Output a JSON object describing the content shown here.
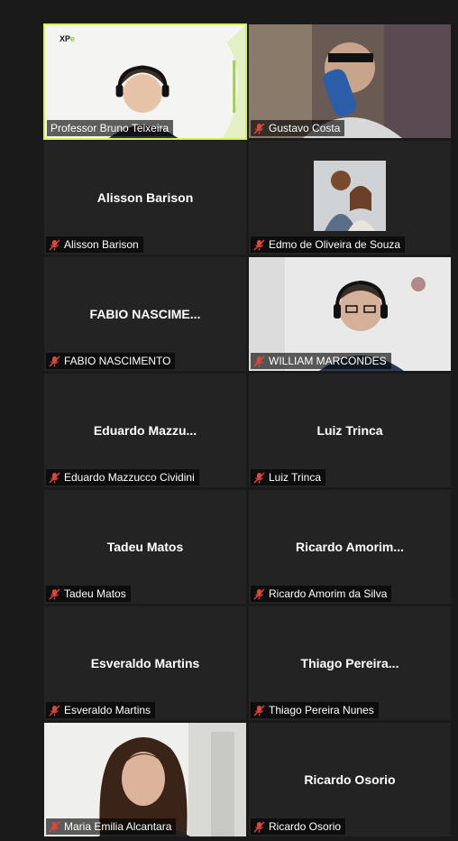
{
  "participants": [
    {
      "name": "Professor Bruno Teixeira",
      "muted": false,
      "video": true
    },
    {
      "name": "Gustavo Costa",
      "muted": true,
      "video": true
    },
    {
      "name": "Alisson Barison",
      "display": "Alisson Barison",
      "muted": true,
      "video": false
    },
    {
      "name": "Edmo de Oliveira de Souza",
      "muted": true,
      "video": false,
      "photo": true
    },
    {
      "name": "FABIO NASCIMENTO",
      "display": "FABIO  NASCIME...",
      "muted": true,
      "video": false
    },
    {
      "name": "WILLIAM MARCONDES",
      "muted": true,
      "video": true
    },
    {
      "name": "Eduardo Mazzucco Cividini",
      "display": "Eduardo  Mazzu...",
      "muted": true,
      "video": false
    },
    {
      "name": "Luiz Trinca",
      "display": "Luiz Trinca",
      "muted": true,
      "video": false
    },
    {
      "name": "Tadeu Matos",
      "display": "Tadeu Matos",
      "muted": true,
      "video": false
    },
    {
      "name": "Ricardo Amorim da Silva",
      "display": "Ricardo  Amorim...",
      "muted": true,
      "video": false
    },
    {
      "name": "Esveraldo Martins",
      "display": "Esveraldo Martins",
      "muted": true,
      "video": false
    },
    {
      "name": "Thiago Pereira Nunes",
      "display": "Thiago  Pereira...",
      "muted": true,
      "video": false
    },
    {
      "name": "Maria Emilia Alcantara",
      "muted": true,
      "video": true
    },
    {
      "name": "Ricardo Osorio",
      "display": "Ricardo Osorio",
      "muted": true,
      "video": false
    }
  ],
  "logo_text": "XP",
  "colors": {
    "active_border": "#d6f05a",
    "muted_icon": "#e0443a"
  }
}
